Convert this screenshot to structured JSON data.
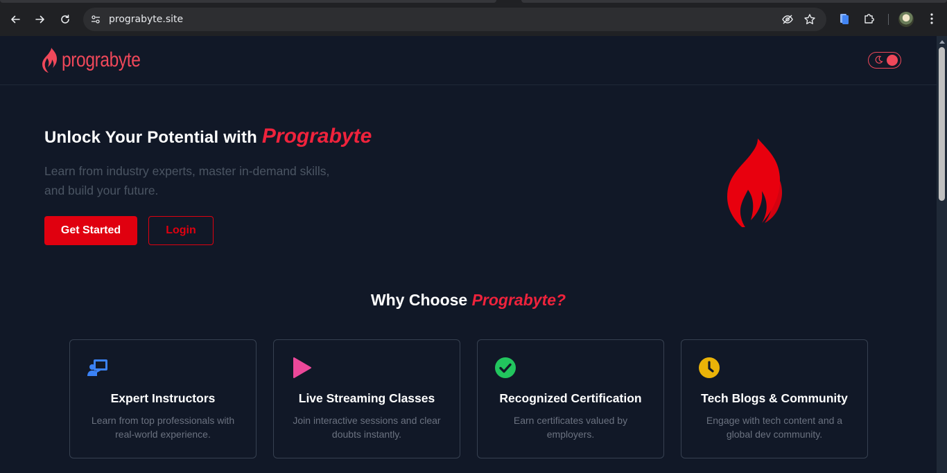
{
  "browser": {
    "url": "prograbyte.site"
  },
  "nav": {
    "logo_text": "prograbyte"
  },
  "hero": {
    "title_prefix": "Unlock Your Potential with",
    "title_brand": "Prograbyte",
    "subtitle": "Learn from industry experts, master in-demand skills, and build your future.",
    "primary_button": "Get Started",
    "secondary_button": "Login"
  },
  "why": {
    "title_prefix": "Why Choose",
    "title_brand": "Prograbyte?"
  },
  "features": [
    {
      "icon": "instructor-icon",
      "icon_color": "#3b82f6",
      "title": "Expert Instructors",
      "desc": "Learn from top professionals with real-world experience."
    },
    {
      "icon": "play-icon",
      "icon_color": "#ec4899",
      "title": "Live Streaming Classes",
      "desc": "Join interactive sessions and clear doubts instantly."
    },
    {
      "icon": "check-circle-icon",
      "icon_color": "#22c55e",
      "title": "Recognized Certification",
      "desc": "Earn certificates valued by employers."
    },
    {
      "icon": "clock-icon",
      "icon_color": "#eab308",
      "title": "Tech Blogs & Community",
      "desc": "Engage with tech content and a global dev community."
    }
  ],
  "colors": {
    "brand": "#ef233c",
    "button": "#e0000f",
    "background": "#111827"
  }
}
